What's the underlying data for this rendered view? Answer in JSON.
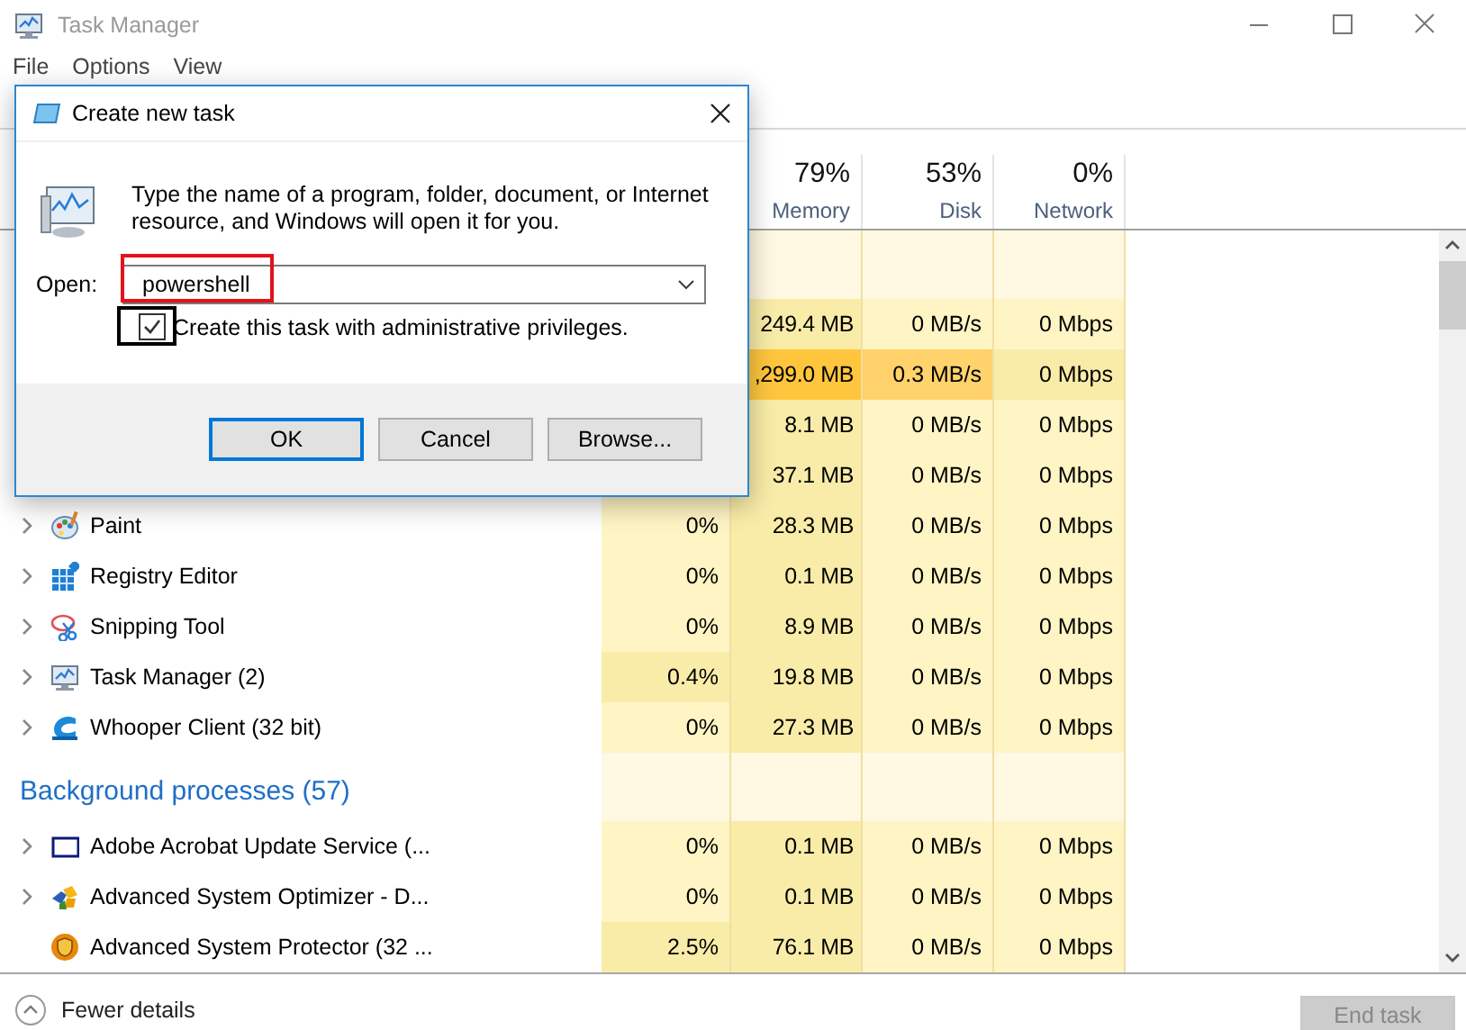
{
  "window": {
    "title": "Task Manager",
    "active": false
  },
  "menu": [
    "File",
    "Options",
    "View"
  ],
  "columns": [
    {
      "percent": "79%",
      "label": "Memory"
    },
    {
      "percent": "53%",
      "label": "Disk"
    },
    {
      "percent": "0%",
      "label": "Network"
    }
  ],
  "rows": [
    {
      "kind": "group"
    },
    {
      "kind": "process",
      "cells": {
        "memory": {
          "value": "249.4 MB",
          "color": "#f9eca8"
        },
        "disk": {
          "value": "0 MB/s",
          "color": "#fff4c4"
        },
        "network": {
          "value": "0 Mbps",
          "color": "#fff4c4"
        }
      }
    },
    {
      "kind": "process",
      "cells": {
        "memory": {
          "value": ",299.0 MB",
          "color": "#ffc63d"
        },
        "disk": {
          "value": "0.3 MB/s",
          "color": "#ffd26b"
        },
        "network": {
          "value": "0 Mbps",
          "color": "#f9eca8"
        }
      }
    },
    {
      "kind": "process",
      "cells": {
        "memory": {
          "value": "8.1 MB",
          "color": "#f9eca8"
        },
        "disk": {
          "value": "0 MB/s",
          "color": "#fff4c4"
        },
        "network": {
          "value": "0 Mbps",
          "color": "#fff4c4"
        }
      }
    },
    {
      "kind": "process",
      "cells": {
        "memory": {
          "value": "37.1 MB",
          "color": "#f9eca8"
        },
        "disk": {
          "value": "0 MB/s",
          "color": "#fff4c4"
        },
        "network": {
          "value": "0 Mbps",
          "color": "#fff4c4"
        }
      }
    },
    {
      "kind": "process",
      "name": "Paint",
      "expandable": true,
      "cells": {
        "cpu": {
          "value": "0%",
          "color": "#fff4c4"
        },
        "memory": {
          "value": "28.3 MB",
          "color": "#f9eca8"
        },
        "disk": {
          "value": "0 MB/s",
          "color": "#fff4c4"
        },
        "network": {
          "value": "0 Mbps",
          "color": "#fff4c4"
        }
      }
    },
    {
      "kind": "process",
      "name": "Registry Editor",
      "expandable": true,
      "cells": {
        "cpu": {
          "value": "0%",
          "color": "#fff4c4"
        },
        "memory": {
          "value": "0.1 MB",
          "color": "#f9eca8"
        },
        "disk": {
          "value": "0 MB/s",
          "color": "#fff4c4"
        },
        "network": {
          "value": "0 Mbps",
          "color": "#fff4c4"
        }
      }
    },
    {
      "kind": "process",
      "name": "Snipping Tool",
      "expandable": true,
      "cells": {
        "cpu": {
          "value": "0%",
          "color": "#fff4c4"
        },
        "memory": {
          "value": "8.9 MB",
          "color": "#f9eca8"
        },
        "disk": {
          "value": "0 MB/s",
          "color": "#fff4c4"
        },
        "network": {
          "value": "0 Mbps",
          "color": "#fff4c4"
        }
      }
    },
    {
      "kind": "process",
      "name": "Task Manager (2)",
      "expandable": true,
      "cells": {
        "cpu": {
          "value": "0.4%",
          "color": "#f9eca8"
        },
        "memory": {
          "value": "19.8 MB",
          "color": "#f9eca8"
        },
        "disk": {
          "value": "0 MB/s",
          "color": "#fff4c4"
        },
        "network": {
          "value": "0 Mbps",
          "color": "#fff4c4"
        }
      }
    },
    {
      "kind": "process",
      "name": "Whooper Client (32 bit)",
      "expandable": true,
      "cells": {
        "cpu": {
          "value": "0%",
          "color": "#fff4c4"
        },
        "memory": {
          "value": "27.3 MB",
          "color": "#f9eca8"
        },
        "disk": {
          "value": "0 MB/s",
          "color": "#fff4c4"
        },
        "network": {
          "value": "0 Mbps",
          "color": "#fff4c4"
        }
      }
    },
    {
      "kind": "group",
      "title": "Background processes (57)"
    },
    {
      "kind": "process",
      "name": "Adobe Acrobat Update Service (...",
      "expandable": true,
      "cells": {
        "cpu": {
          "value": "0%",
          "color": "#fff4c4"
        },
        "memory": {
          "value": "0.1 MB",
          "color": "#f9eca8"
        },
        "disk": {
          "value": "0 MB/s",
          "color": "#fff4c4"
        },
        "network": {
          "value": "0 Mbps",
          "color": "#fff4c4"
        }
      }
    },
    {
      "kind": "process",
      "name": "Advanced System Optimizer - D...",
      "expandable": true,
      "cells": {
        "cpu": {
          "value": "0%",
          "color": "#fff4c4"
        },
        "memory": {
          "value": "0.1 MB",
          "color": "#f9eca8"
        },
        "disk": {
          "value": "0 MB/s",
          "color": "#fff4c4"
        },
        "network": {
          "value": "0 Mbps",
          "color": "#fff4c4"
        }
      }
    },
    {
      "kind": "process",
      "name": "Advanced System Protector (32 ...",
      "expandable": false,
      "cells": {
        "cpu": {
          "value": "2.5%",
          "color": "#f9eca8"
        },
        "memory": {
          "value": "76.1 MB",
          "color": "#f9eca8"
        },
        "disk": {
          "value": "0 MB/s",
          "color": "#fff4c4"
        },
        "network": {
          "value": "0 Mbps",
          "color": "#fff4c4"
        }
      }
    }
  ],
  "footer": {
    "fewer_details": "Fewer details",
    "end_task": {
      "label": "End task",
      "disabled": true
    }
  },
  "dialog": {
    "title": "Create new task",
    "message": "Type the name of a program, folder, document, or Internet resource, and Windows will open it for you.",
    "open_label": "Open:",
    "open_field": {
      "value": "powershell",
      "annotation": {
        "color": "#e3121b"
      }
    },
    "admin_checkbox": {
      "label": "Create this task with administrative privileges.",
      "checked": true,
      "annotation": {
        "color": "#000000"
      }
    },
    "buttons": [
      {
        "label": "OK",
        "default": true
      },
      {
        "label": "Cancel",
        "default": false
      },
      {
        "label": "Browse...",
        "default": false
      }
    ]
  }
}
